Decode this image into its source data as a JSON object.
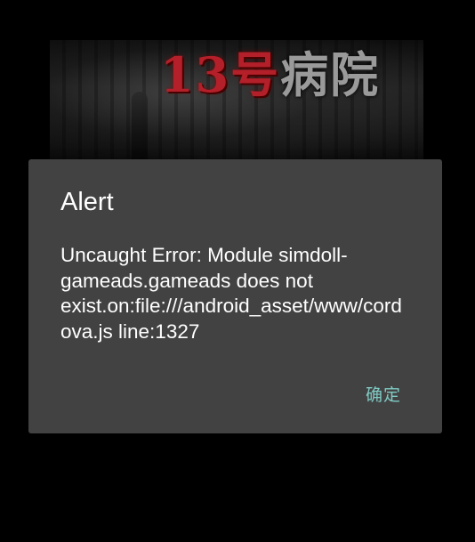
{
  "background": {
    "banner_title_red": "13号",
    "banner_title_grey": "病院"
  },
  "dialog": {
    "title": "Alert",
    "message": "Uncaught Error: Module simdoll-gameads.gameads does not exist.on:file:///android_asset/www/cordova.js line:1327",
    "ok_label": "确定",
    "ok_color": "#80cbc4",
    "background_color": "#424242"
  }
}
